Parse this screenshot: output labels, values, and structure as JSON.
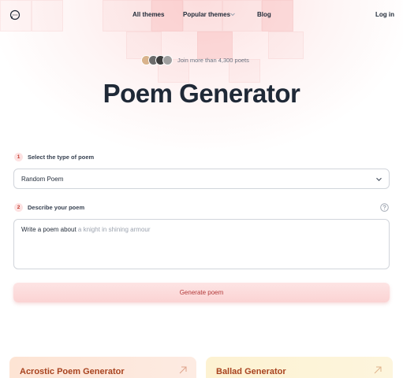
{
  "nav": {
    "logo_icon": "chat-bubble-icon",
    "links": [
      {
        "label": "All themes"
      },
      {
        "label": "Popular themes"
      },
      {
        "label": "Blog"
      }
    ],
    "login_label": "Log in"
  },
  "hero": {
    "social_proof": "Join more than 4,300 poets",
    "title": "Poem Generator"
  },
  "form": {
    "step1": {
      "number": "1",
      "label": "Select the type of poem",
      "value": "Random Poem"
    },
    "step2": {
      "number": "2",
      "label": "Describe your poem",
      "prefix": "Write a poem about",
      "placeholder": "a knight in shining armour",
      "help_icon": "question-circle-icon"
    },
    "submit_label": "Generate poem"
  },
  "cards": [
    {
      "title": "Acrostic Poem Generator",
      "icon": "arrow-up-right-icon"
    },
    {
      "title": "Ballad Generator",
      "icon": "arrow-up-right-icon"
    }
  ],
  "colors": {
    "accent": "#b23a3a",
    "button_bg": "#fbd3d3",
    "card_title": "#a8431f"
  }
}
